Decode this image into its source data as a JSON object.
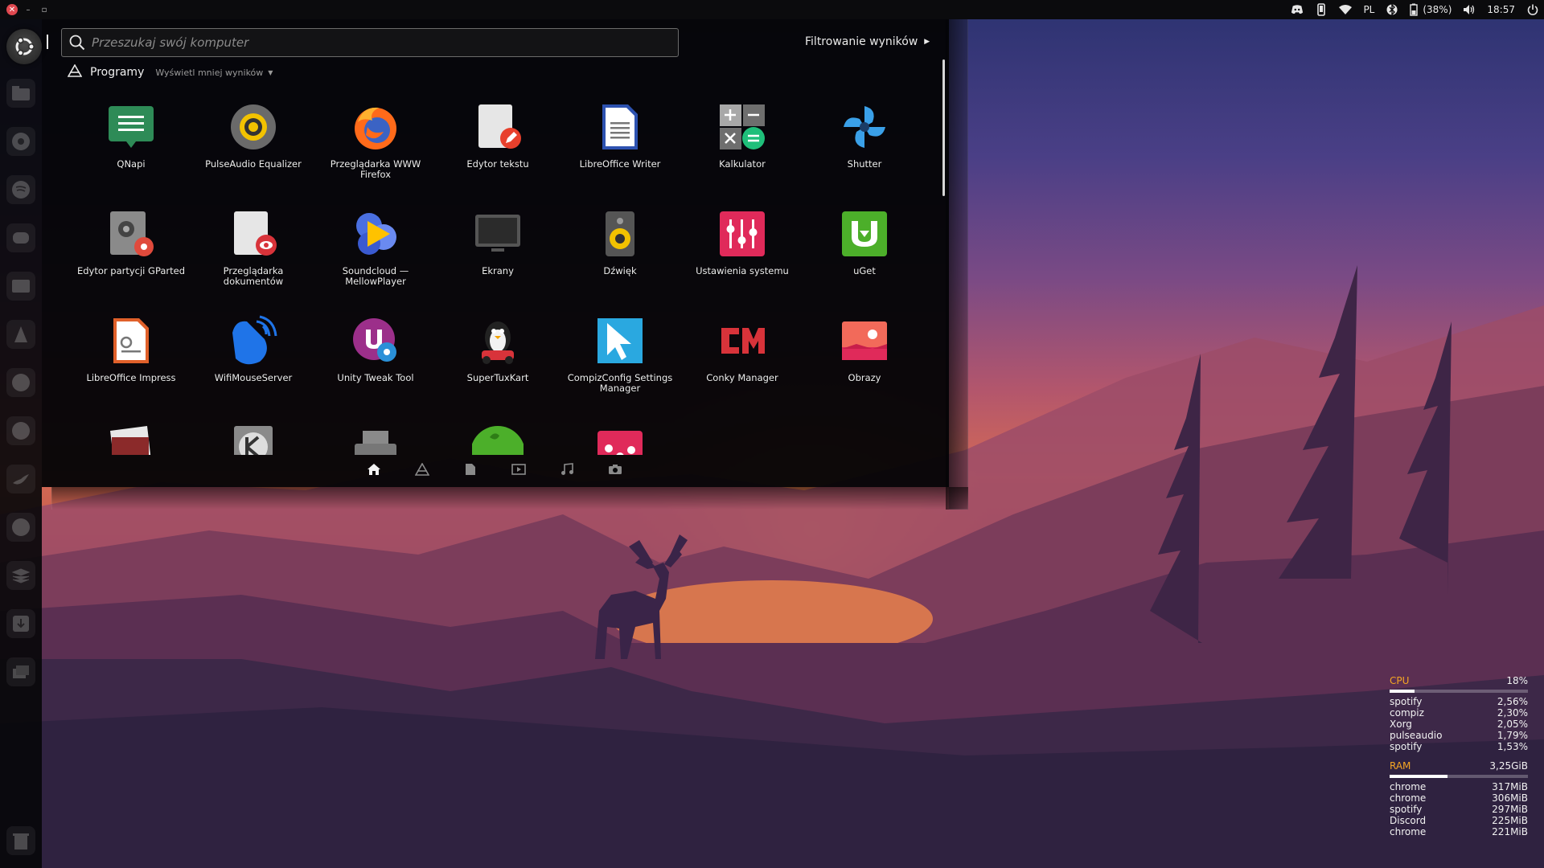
{
  "top_panel": {
    "window_controls": [
      "close-icon",
      "minimize-icon",
      "maximize-icon"
    ],
    "keyboard_layout": "PL",
    "battery": "(38%)",
    "clock": "18:57",
    "tray_icons": [
      "discord-icon",
      "phone-icon",
      "wifi-icon",
      "keyboard-layout",
      "bluetooth-icon",
      "battery-icon",
      "volume-icon",
      "clock",
      "power-icon"
    ]
  },
  "dash": {
    "search": {
      "placeholder": "Przeszukaj swój komputer",
      "value": ""
    },
    "filter_label": "Filtrowanie wyników",
    "section": {
      "title": "Programy",
      "show_less": "Wyświetl mniej wyników"
    },
    "apps": [
      {
        "label": "QNapi",
        "icon": "qnapi-icon"
      },
      {
        "label": "PulseAudio Equalizer",
        "icon": "pulseaudio-equalizer-icon"
      },
      {
        "label": "Przeglądarka WWW Firefox",
        "icon": "firefox-icon"
      },
      {
        "label": "Edytor tekstu",
        "icon": "text-editor-icon"
      },
      {
        "label": "LibreOffice Writer",
        "icon": "libreoffice-writer-icon"
      },
      {
        "label": "Kalkulator",
        "icon": "calculator-icon"
      },
      {
        "label": "Shutter",
        "icon": "shutter-icon"
      },
      {
        "label": "Edytor partycji GParted",
        "icon": "gparted-icon"
      },
      {
        "label": "Przeglądarka dokumentów",
        "icon": "document-viewer-icon"
      },
      {
        "label": "Soundcloud — MellowPlayer",
        "icon": "mellowplayer-icon"
      },
      {
        "label": "Ekrany",
        "icon": "displays-icon"
      },
      {
        "label": "Dźwięk",
        "icon": "sound-icon"
      },
      {
        "label": "Ustawienia systemu",
        "icon": "system-settings-icon"
      },
      {
        "label": "uGet",
        "icon": "uget-icon"
      },
      {
        "label": "LibreOffice Impress",
        "icon": "libreoffice-impress-icon"
      },
      {
        "label": "WifiMouseServer",
        "icon": "wifimouse-icon"
      },
      {
        "label": "Unity Tweak Tool",
        "icon": "unity-tweak-tool-icon"
      },
      {
        "label": "SuperTuxKart",
        "icon": "supertuxkart-icon"
      },
      {
        "label": "CompizConfig Settings Manager",
        "icon": "ccsm-icon"
      },
      {
        "label": "Conky Manager",
        "icon": "conky-manager-icon"
      },
      {
        "label": "Obrazy",
        "icon": "images-icon"
      },
      {
        "label": "",
        "icon": "archive-manager-icon"
      },
      {
        "label": "",
        "icon": "kde-connect-icon"
      },
      {
        "label": "",
        "icon": "usb-creator-icon"
      },
      {
        "label": "",
        "icon": "evernote-icon"
      },
      {
        "label": "",
        "icon": "settings-sliders-icon"
      }
    ],
    "lenses": [
      "home-icon",
      "applications-icon",
      "files-icon",
      "video-icon",
      "music-icon",
      "photos-icon"
    ]
  },
  "launcher_icons": [
    "files-icon",
    "chrome-icon",
    "spotify-icon",
    "discord-icon",
    "terminal-icon",
    "vlc-icon",
    "yakyak-icon",
    "steam-icon",
    "twitter-icon",
    "dropbox-icon",
    "stack-icon",
    "download-icon",
    "workspaces-icon",
    "trash-icon"
  ],
  "conky": {
    "cpu": {
      "label": "CPU",
      "value": "18%",
      "fraction": 0.18,
      "processes": [
        {
          "name": "spotify",
          "value": "2,56%"
        },
        {
          "name": "compiz",
          "value": "2,30%"
        },
        {
          "name": "Xorg",
          "value": "2,05%"
        },
        {
          "name": "pulseaudio",
          "value": "1,79%"
        },
        {
          "name": "spotify",
          "value": "1,53%"
        }
      ]
    },
    "ram": {
      "label": "RAM",
      "value": "3,25GiB",
      "fraction": 0.42,
      "processes": [
        {
          "name": "chrome",
          "value": "317MiB"
        },
        {
          "name": "chrome",
          "value": "306MiB"
        },
        {
          "name": "spotify",
          "value": "297MiB"
        },
        {
          "name": "Discord",
          "value": "225MiB"
        },
        {
          "name": "chrome",
          "value": "221MiB"
        }
      ]
    },
    "colors": {
      "label": "#f5a623",
      "text": "#f2f2f2"
    }
  }
}
